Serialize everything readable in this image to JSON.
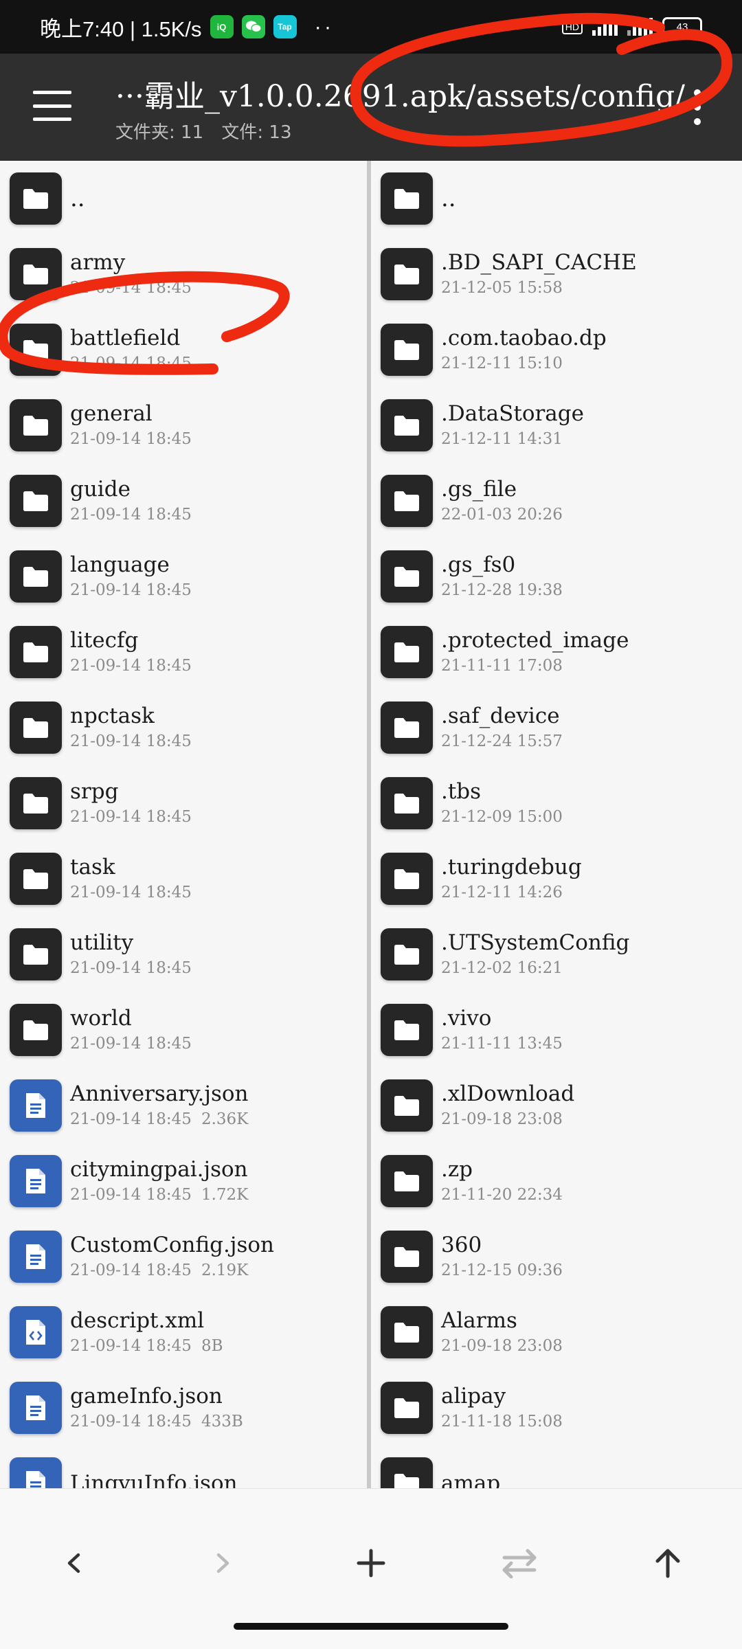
{
  "status_bar": {
    "time_speed": "晚上7:40 | 1.5K/s",
    "apps": [
      "iQIYI",
      "微",
      "Tap"
    ],
    "more": "··",
    "hd": "HD",
    "battery": "43"
  },
  "toolbar": {
    "path": "···霸业_v1.0.0.2691.apk/assets/config/",
    "folder_count": "文件夹: 11",
    "file_count": "文件: 13"
  },
  "left_pane": {
    "items": [
      {
        "name": "..",
        "meta": "",
        "size": "",
        "kind": "folder"
      },
      {
        "name": "army",
        "meta": "21-09-14 18:45",
        "size": "",
        "kind": "folder"
      },
      {
        "name": "battlefield",
        "meta": "21-09-14 18:45",
        "size": "",
        "kind": "folder"
      },
      {
        "name": "general",
        "meta": "21-09-14 18:45",
        "size": "",
        "kind": "folder"
      },
      {
        "name": "guide",
        "meta": "21-09-14 18:45",
        "size": "",
        "kind": "folder"
      },
      {
        "name": "language",
        "meta": "21-09-14 18:45",
        "size": "",
        "kind": "folder"
      },
      {
        "name": "litecfg",
        "meta": "21-09-14 18:45",
        "size": "",
        "kind": "folder"
      },
      {
        "name": "npctask",
        "meta": "21-09-14 18:45",
        "size": "",
        "kind": "folder"
      },
      {
        "name": "srpg",
        "meta": "21-09-14 18:45",
        "size": "",
        "kind": "folder"
      },
      {
        "name": "task",
        "meta": "21-09-14 18:45",
        "size": "",
        "kind": "folder"
      },
      {
        "name": "utility",
        "meta": "21-09-14 18:45",
        "size": "",
        "kind": "folder"
      },
      {
        "name": "world",
        "meta": "21-09-14 18:45",
        "size": "",
        "kind": "folder"
      },
      {
        "name": "Anniversary.json",
        "meta": "21-09-14 18:45",
        "size": "2.36K",
        "kind": "file"
      },
      {
        "name": "citymingpai.json",
        "meta": "21-09-14 18:45",
        "size": "1.72K",
        "kind": "file"
      },
      {
        "name": "CustomConfig.json",
        "meta": "21-09-14 18:45",
        "size": "2.19K",
        "kind": "file"
      },
      {
        "name": "descript.xml",
        "meta": "21-09-14 18:45",
        "size": "8B",
        "kind": "xml"
      },
      {
        "name": "gameInfo.json",
        "meta": "21-09-14 18:45",
        "size": "433B",
        "kind": "file"
      },
      {
        "name": "LingyuInfo.json",
        "meta": "",
        "size": "",
        "kind": "file"
      }
    ]
  },
  "right_pane": {
    "items": [
      {
        "name": "..",
        "meta": ""
      },
      {
        "name": ".BD_SAPI_CACHE",
        "meta": "21-12-05 15:58"
      },
      {
        "name": ".com.taobao.dp",
        "meta": "21-12-11 15:10"
      },
      {
        "name": ".DataStorage",
        "meta": "21-12-11 14:31"
      },
      {
        "name": ".gs_file",
        "meta": "22-01-03 20:26"
      },
      {
        "name": ".gs_fs0",
        "meta": "21-12-28 19:38"
      },
      {
        "name": ".protected_image",
        "meta": "21-11-11 17:08"
      },
      {
        "name": ".saf_device",
        "meta": "21-12-24 15:57"
      },
      {
        "name": ".tbs",
        "meta": "21-12-09 15:00"
      },
      {
        "name": ".turingdebug",
        "meta": "21-12-11 14:26"
      },
      {
        "name": ".UTSystemConfig",
        "meta": "21-12-02 16:21"
      },
      {
        "name": ".vivo",
        "meta": "21-11-11 13:45"
      },
      {
        "name": ".xlDownload",
        "meta": "21-09-18 23:08"
      },
      {
        "name": ".zp",
        "meta": "21-11-20 22:34"
      },
      {
        "name": "360",
        "meta": "21-12-15 09:36"
      },
      {
        "name": "Alarms",
        "meta": "21-09-18 23:08"
      },
      {
        "name": "alipay",
        "meta": "21-11-18 15:08"
      },
      {
        "name": "amap",
        "meta": ""
      }
    ]
  },
  "bottom_nav": {
    "buttons": [
      "back-icon",
      "forward-icon",
      "add-icon",
      "swap-icon",
      "up-icon"
    ]
  },
  "colors": {
    "toolbar": "#2f2f2f",
    "folder_icon": "#262626",
    "file_icon": "#3464b8",
    "annotation": "#ee2a10"
  }
}
